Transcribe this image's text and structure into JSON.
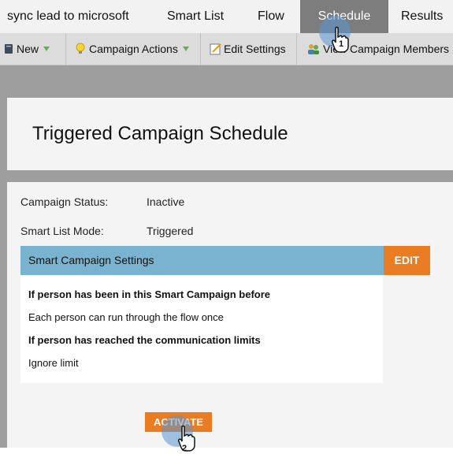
{
  "tabs": [
    {
      "label": "sync lead to microsoft"
    },
    {
      "label": "Smart List"
    },
    {
      "label": "Flow"
    },
    {
      "label": "Schedule"
    },
    {
      "label": "Results"
    }
  ],
  "active_tab": "Schedule",
  "toolbar": {
    "new_label": "New",
    "campaign_actions_label": "Campaign Actions",
    "edit_settings_label": "Edit Settings",
    "view_members_label": "View Campaign Members"
  },
  "page_title": "Triggered Campaign Schedule",
  "status": {
    "campaign_status_label": "Campaign Status:",
    "campaign_status_value": "Inactive",
    "smart_list_mode_label": "Smart List Mode:",
    "smart_list_mode_value": "Triggered"
  },
  "settings": {
    "header": "Smart Campaign Settings",
    "edit_label": "EDIT",
    "line1": "If person has been in this Smart Campaign before",
    "line2": "Each person can run through the flow once",
    "line3": "If person has reached the communication limits",
    "line4": "Ignore limit"
  },
  "activate_label": "ACTIVATE",
  "step_markers": [
    "1",
    "2"
  ],
  "colors": {
    "accent_orange": "#ea7c24",
    "settings_header_blue": "#7ab3cf",
    "workspace_gray": "#9e9e9e",
    "active_tab_gray": "#7d7d7d"
  }
}
